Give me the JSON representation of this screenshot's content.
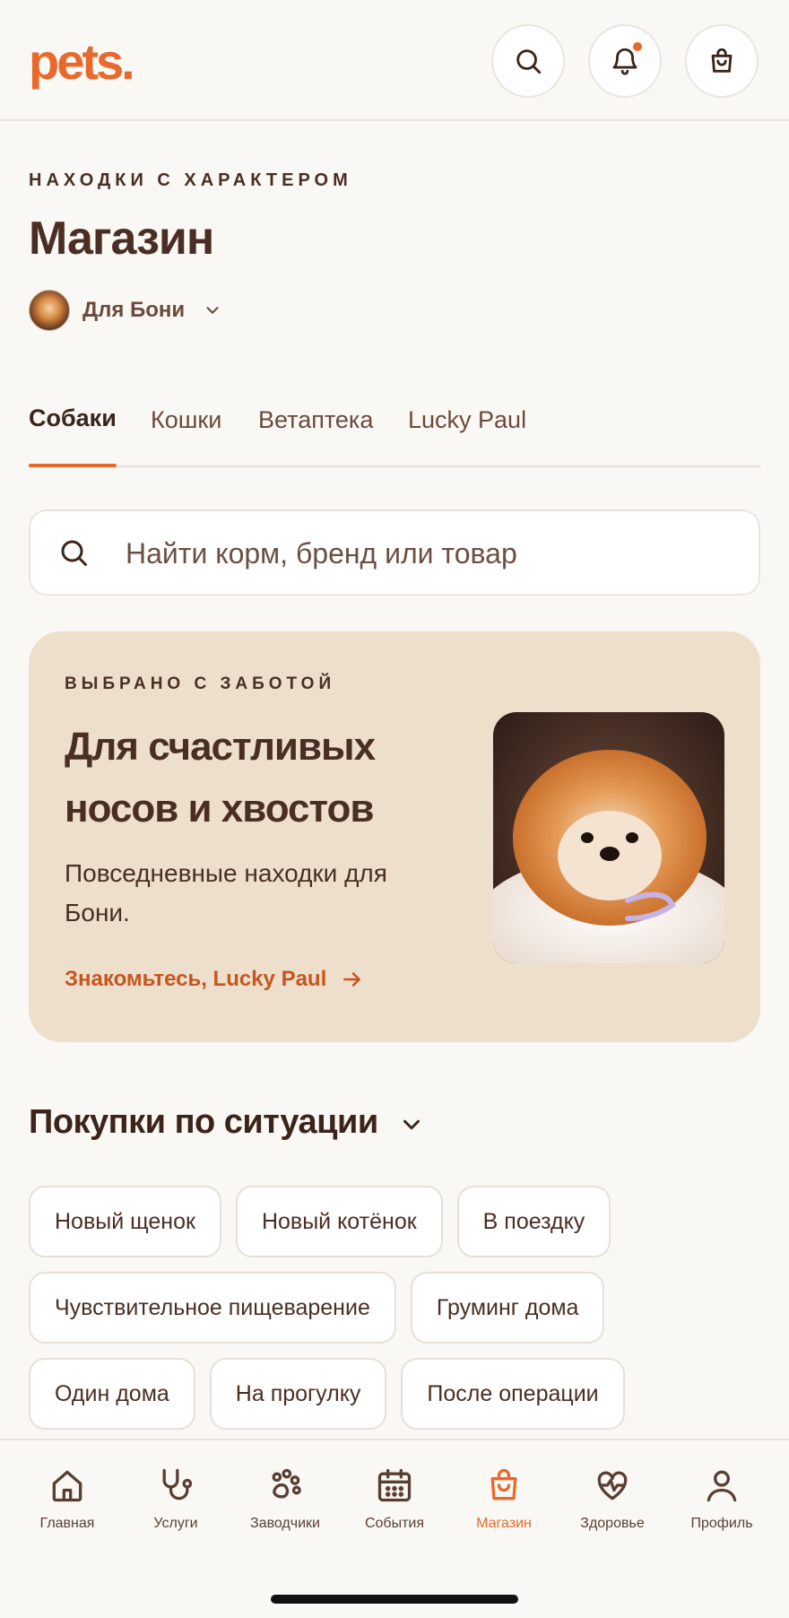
{
  "header": {
    "logo": "pets.",
    "notification_dot_color": "#E8692B",
    "icons": [
      "search-icon",
      "bell-icon",
      "shopping-bag-icon"
    ]
  },
  "page": {
    "eyebrow": "НАХОДКИ С ХАРАКТЕРОМ",
    "title": "Магазин",
    "pet_selector": {
      "label": "Для Бони"
    }
  },
  "tabs": [
    {
      "label": "Собаки",
      "active": true
    },
    {
      "label": "Кошки",
      "active": false
    },
    {
      "label": "Ветаптека",
      "active": false
    },
    {
      "label": "Lucky Paul",
      "active": false
    }
  ],
  "search": {
    "placeholder": "Найти корм, бренд или товар",
    "value": ""
  },
  "promo": {
    "eyebrow": "ВЫБРАНО С ЗАБОТОЙ",
    "title": "Для счастливых носов и хвостов",
    "description": "Повседневные находки для Бони.",
    "link": "Знакомьтесь, Lucky Paul"
  },
  "situations": {
    "title": "Покупки по ситуации",
    "chips": [
      "Новый щенок",
      "Новый котёнок",
      "В поездку",
      "Чувствительное пищеварение",
      "Груминг дома",
      "Один дома",
      "На прогулку",
      "После операции"
    ]
  },
  "bottom_nav": [
    {
      "label": "Главная",
      "icon": "home-icon",
      "active": false
    },
    {
      "label": "Услуги",
      "icon": "stethoscope-icon",
      "active": false
    },
    {
      "label": "Заводчики",
      "icon": "paw-icon",
      "active": false
    },
    {
      "label": "События",
      "icon": "calendar-icon",
      "active": false
    },
    {
      "label": "Магазин",
      "icon": "shopping-bag-icon",
      "active": true
    },
    {
      "label": "Здоровье",
      "icon": "heart-pulse-icon",
      "active": false
    },
    {
      "label": "Профиль",
      "icon": "user-icon",
      "active": false
    }
  ],
  "colors": {
    "accent": "#E8692B",
    "background": "#FAF8F4",
    "promo_background": "#EDDFCC",
    "text": "#4A2E24"
  }
}
